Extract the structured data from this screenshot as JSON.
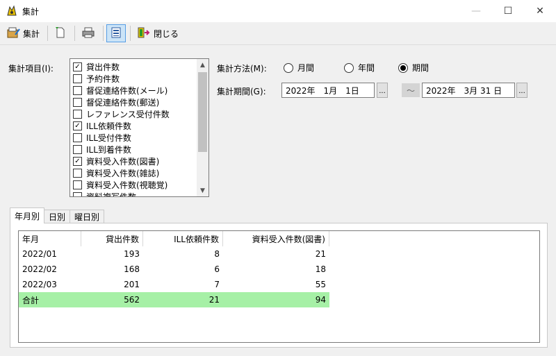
{
  "window": {
    "title": "集計",
    "minimize": "—",
    "maximize": "☐",
    "close": "✕"
  },
  "toolbar": {
    "aggregate_label": "集計",
    "close_label": "閉じる"
  },
  "form": {
    "items_label": "集計項目(I):",
    "items": [
      {
        "label": "貸出件数",
        "checked": true
      },
      {
        "label": "予約件数",
        "checked": false
      },
      {
        "label": "督促連絡件数(メール)",
        "checked": false
      },
      {
        "label": "督促連絡件数(郵送)",
        "checked": false
      },
      {
        "label": "レファレンス受付件数",
        "checked": false
      },
      {
        "label": "ILL依頼件数",
        "checked": true
      },
      {
        "label": "ILL受付件数",
        "checked": false
      },
      {
        "label": "ILL到着件数",
        "checked": false
      },
      {
        "label": "資料受入件数(図書)",
        "checked": true
      },
      {
        "label": "資料受入件数(雑誌)",
        "checked": false
      },
      {
        "label": "資料受入件数(視聴覚)",
        "checked": false
      },
      {
        "label": "資料複写件数",
        "checked": false
      }
    ],
    "method_label": "集計方法(M):",
    "methods": [
      {
        "label": "月間",
        "selected": false
      },
      {
        "label": "年間",
        "selected": false
      },
      {
        "label": "期間",
        "selected": true
      }
    ],
    "period_label": "集計期間(G):",
    "date_from": "2022年　1月　1日",
    "date_to": "2022年　3月 31 日",
    "tilde": "～",
    "ellipsis": "..."
  },
  "tabs": [
    "年月別",
    "日別",
    "曜日別"
  ],
  "table": {
    "headers": [
      "年月",
      "貸出件数",
      "ILL依頼件数",
      "資料受入件数(図書)"
    ],
    "rows": [
      [
        "2022/01",
        "193",
        "8",
        "21"
      ],
      [
        "2022/02",
        "168",
        "6",
        "18"
      ],
      [
        "2022/03",
        "201",
        "7",
        "55"
      ]
    ],
    "total": [
      "合計",
      "562",
      "21",
      "94"
    ]
  },
  "colors": {
    "total_row": "#a6f0a6",
    "selected_tool": "#cce4f7"
  }
}
